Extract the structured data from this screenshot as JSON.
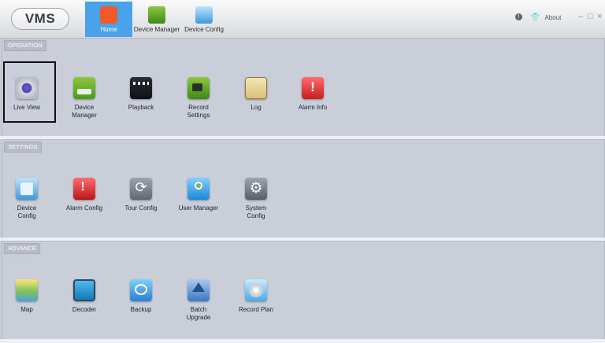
{
  "app": {
    "logo": "VMS"
  },
  "nav": {
    "tabs": [
      {
        "label": "Home",
        "icon": "home-icon",
        "active": true
      },
      {
        "label": "Device Manager",
        "icon": "device-manager-icon",
        "active": false
      },
      {
        "label": "Device Config",
        "icon": "device-config-icon",
        "active": false
      }
    ],
    "about": "About"
  },
  "sections": {
    "operation": {
      "label": "OPERATION",
      "items": [
        {
          "label": "Live View",
          "icon": "live-view-icon"
        },
        {
          "label": "Device Manager",
          "icon": "device-manager-icon"
        },
        {
          "label": "Playback",
          "icon": "playback-icon"
        },
        {
          "label": "Record Settings",
          "icon": "record-settings-icon"
        },
        {
          "label": "Log",
          "icon": "log-icon"
        },
        {
          "label": "Alarm Info",
          "icon": "alarm-info-icon"
        }
      ]
    },
    "settings": {
      "label": "SETTINGS",
      "items": [
        {
          "label": "Device Config",
          "icon": "device-config-icon"
        },
        {
          "label": "Alarm Config",
          "icon": "alarm-config-icon"
        },
        {
          "label": "Tour Config",
          "icon": "tour-config-icon"
        },
        {
          "label": "User Manager",
          "icon": "user-manager-icon"
        },
        {
          "label": "System Config",
          "icon": "system-config-icon"
        }
      ]
    },
    "advance": {
      "label": "ADVANCE",
      "items": [
        {
          "label": "Map",
          "icon": "map-icon"
        },
        {
          "label": "Decoder",
          "icon": "decoder-icon"
        },
        {
          "label": "Backup",
          "icon": "backup-icon"
        },
        {
          "label": "Batch Upgrade",
          "icon": "batch-upgrade-icon"
        },
        {
          "label": "Record Plan",
          "icon": "record-plan-icon"
        }
      ]
    }
  },
  "colors": {
    "active_tab": "#4aa3ea",
    "background": "#c8cdd6"
  }
}
